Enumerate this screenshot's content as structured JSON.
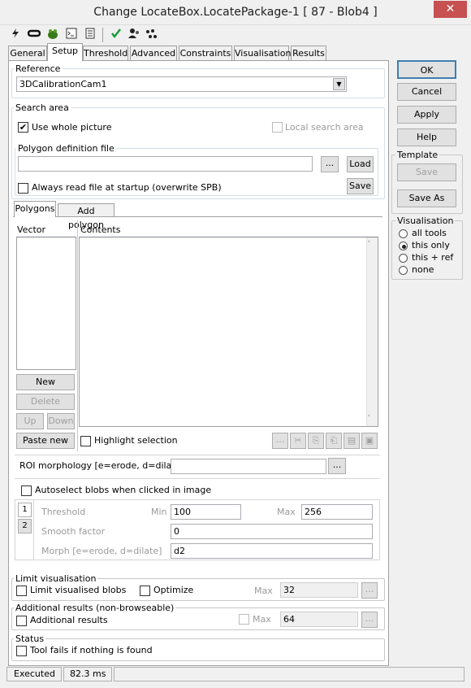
{
  "window": {
    "title": "Change LocateBox.LocatePackage-1 [ 87 - Blob4 ]",
    "close": "✕"
  },
  "toolbar": {
    "icons": [
      "lightning-icon",
      "link-icon",
      "frog-icon",
      "console-icon",
      "document-icon",
      "check-icon",
      "people-icon",
      "blob-icon"
    ]
  },
  "tabs": [
    "General",
    "Setup",
    "Threshold",
    "Advanced",
    "Constraints",
    "Visualisation",
    "Results"
  ],
  "reference": {
    "label": "Reference",
    "value": "3DCalibrationCam1"
  },
  "search_area": {
    "label": "Search area",
    "use_whole_picture": "Use whole picture",
    "local_search_area": "Local search area",
    "polygon_label": "Polygon definition file",
    "polygon_value": "",
    "browse": "...",
    "load": "Load",
    "always_read": "Always read file at startup (overwrite SPB)",
    "save": "Save"
  },
  "subtabs": [
    "Polygons",
    "Add polygon"
  ],
  "polygons": {
    "vector_header": "Vector",
    "contents_header": "Contents",
    "new": "New",
    "delete": "Delete",
    "up": "Up",
    "down": "Down",
    "paste_new": "Paste new",
    "highlight_selection": "Highlight selection"
  },
  "roi": {
    "label": "ROI morphology [e=erode, d=dilate]",
    "value": "",
    "browse": "..."
  },
  "autoselect": "Autoselect blobs when clicked in image",
  "threshold_block": {
    "side_tabs": [
      "1",
      "2"
    ],
    "threshold": "Threshold",
    "min": "Min",
    "min_value": "100",
    "max": "Max",
    "max_value": "256",
    "smooth_factor": "Smooth factor",
    "smooth_value": "0",
    "morph": "Morph [e=erode, d=dilate]",
    "morph_value": "d2"
  },
  "limit_visualisation": {
    "label": "Limit visualisation",
    "limit_blobs": "Limit visualised blobs",
    "optimize": "Optimize",
    "max": "Max",
    "max_value": "32",
    "browse": "..."
  },
  "additional_results": {
    "label": "Additional results (non-browseable)",
    "checkbox": "Additional results",
    "max": "Max",
    "max_value": "64",
    "browse": "..."
  },
  "status": {
    "label": "Status",
    "tool_fails": "Tool fails if nothing is found"
  },
  "statusbar": {
    "state": "Executed",
    "time": "82.3 ms"
  },
  "right": {
    "ok": "OK",
    "cancel": "Cancel",
    "apply": "Apply",
    "help": "Help",
    "template_label": "Template",
    "template_save": "Save",
    "save_as": "Save As",
    "visualisation_label": "Visualisation",
    "options": [
      "all tools",
      "this only",
      "this + ref",
      "none"
    ],
    "selected": "this only"
  }
}
